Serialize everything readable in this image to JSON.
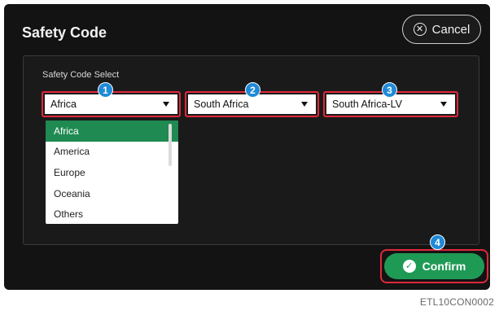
{
  "dialog": {
    "title": "Safety Code",
    "cancel_label": "Cancel",
    "confirm_label": "Confirm"
  },
  "panel": {
    "label": "Safety Code  Select"
  },
  "selects": [
    {
      "value": "Africa",
      "badge": "1"
    },
    {
      "value": "South Africa",
      "badge": "2"
    },
    {
      "value": "South Africa-LV",
      "badge": "3"
    }
  ],
  "dropdown": {
    "options": [
      "Africa",
      "America",
      "Europe",
      "Oceania",
      "Others"
    ],
    "selected": "Africa"
  },
  "confirm_badge": "4",
  "image_code": "ETL10CON0002",
  "colors": {
    "highlight": "#e0283a",
    "badge": "#1f8ad7",
    "confirm": "#1f9a55",
    "selected_option": "#1f8a52"
  }
}
